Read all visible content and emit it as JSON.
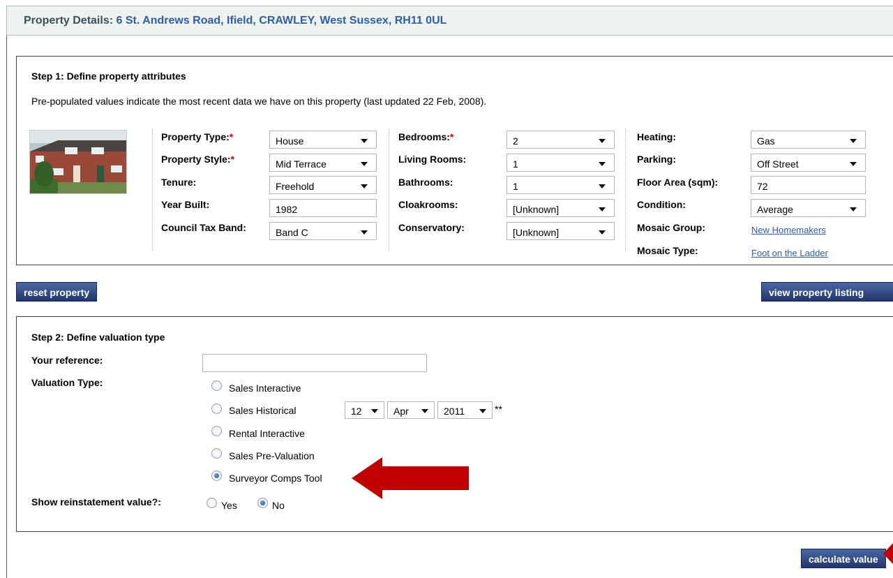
{
  "header": {
    "title_label": "Property Details:",
    "address": "6 St. Andrews Road, Ifield, CRAWLEY, West Sussex, RH11 0UL"
  },
  "step1": {
    "title": "Step 1: Define property attributes",
    "intro": "Pre-populated values indicate the most recent data we have on this property (last updated 22 Feb, 2008).",
    "required_mark": "*",
    "col1": {
      "property_type": {
        "label": "Property Type:",
        "value": "House"
      },
      "property_style": {
        "label": "Property Style:",
        "value": "Mid Terrace"
      },
      "tenure": {
        "label": "Tenure:",
        "value": "Freehold"
      },
      "year_built": {
        "label": "Year Built:",
        "value": "1982"
      },
      "council_tax": {
        "label": "Council Tax Band:",
        "value": "Band C"
      }
    },
    "col2": {
      "bedrooms": {
        "label": "Bedrooms:",
        "value": "2"
      },
      "living_rooms": {
        "label": "Living Rooms:",
        "value": "1"
      },
      "bathrooms": {
        "label": "Bathrooms:",
        "value": "1"
      },
      "cloakrooms": {
        "label": "Cloakrooms:",
        "value": "[Unknown]"
      },
      "conservatory": {
        "label": "Conservatory:",
        "value": "[Unknown]"
      }
    },
    "col3": {
      "heating": {
        "label": "Heating:",
        "value": "Gas"
      },
      "parking": {
        "label": "Parking:",
        "value": "Off Street"
      },
      "floor_area": {
        "label": "Floor Area (sqm):",
        "value": "72"
      },
      "condition": {
        "label": "Condition:",
        "value": "Average"
      },
      "mosaic_group": {
        "label": "Mosaic Group:",
        "value": "New Homemakers"
      },
      "mosaic_type": {
        "label": "Mosaic Type:",
        "value": "Foot on the Ladder"
      }
    }
  },
  "buttons": {
    "reset": "reset property",
    "view_listing": "view property listing",
    "calculate": "calculate value"
  },
  "step2": {
    "title": "Step 2: Define valuation type",
    "reference_label": "Your reference:",
    "reference_value": "",
    "valuation_label": "Valuation Type:",
    "options": [
      {
        "label": "Sales Interactive",
        "selected": false
      },
      {
        "label": "Sales Historical",
        "selected": false
      },
      {
        "label": "Rental Interactive",
        "selected": false
      },
      {
        "label": "Sales Pre-Valuation",
        "selected": false
      },
      {
        "label": "Surveyor Comps Tool",
        "selected": true
      }
    ],
    "historical_date": {
      "day": "12",
      "month": "Apr",
      "year": "2011",
      "note": "**"
    },
    "reinstatement_label": "Show reinstatement value?:",
    "reinstatement_yes": "Yes",
    "reinstatement_no": "No",
    "reinstatement_selected": "No"
  },
  "colors": {
    "header_bg": "#eef3f0",
    "link": "#2f5da8",
    "button": "#2f4a86",
    "annotation_arrow": "#c00000"
  }
}
